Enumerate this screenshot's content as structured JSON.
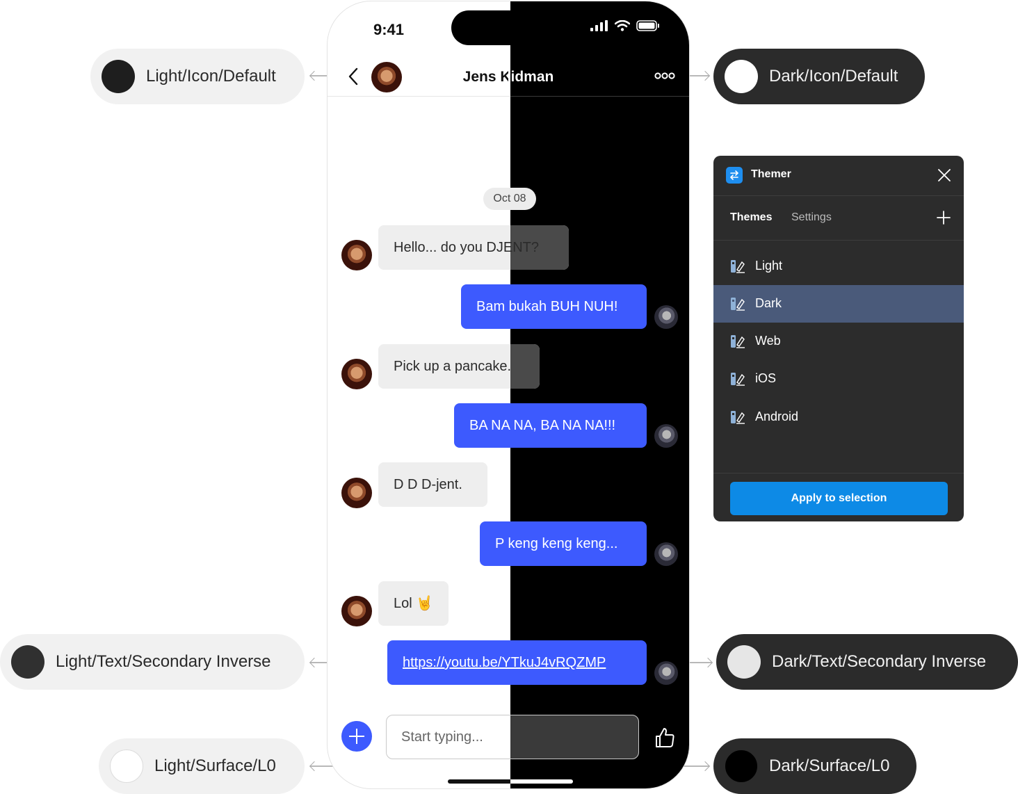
{
  "tokens": {
    "light_icon": {
      "label": "Light/Icon/Default",
      "color": "#1e1e1e"
    },
    "dark_icon": {
      "label": "Dark/Icon/Default",
      "color": "#ffffff"
    },
    "light_text": {
      "label": "Light/Text/Secondary Inverse",
      "color": "#303030"
    },
    "dark_text": {
      "label": "Dark/Text/Secondary Inverse",
      "color": "#e6e6e6"
    },
    "light_surface": {
      "label": "Light/Surface/L0",
      "color": "#ffffff"
    },
    "dark_surface": {
      "label": "Dark/Surface/L0",
      "color": "#000000"
    }
  },
  "phone": {
    "time": "9:41",
    "contact": "Jens Kidman",
    "date_chip": "Oct 08",
    "messages": [
      {
        "dir": "in",
        "text": "Hello... do you DJENT?"
      },
      {
        "dir": "out",
        "text": "Bam bukah BUH NUH!"
      },
      {
        "dir": "in",
        "text": "Pick up a pancake."
      },
      {
        "dir": "out",
        "text": "BA NA NA, BA NA NA!!!"
      },
      {
        "dir": "in",
        "text": "D D D-jent."
      },
      {
        "dir": "out",
        "text": "P keng keng keng..."
      },
      {
        "dir": "in",
        "text": "Lol 🤘"
      },
      {
        "dir": "out",
        "text": "https://youtu.be/YTkuJ4vRQZMP",
        "link": true
      }
    ],
    "input_placeholder": "Start typing...",
    "colors": {
      "bubble_out": "#3d5afe",
      "bubble_in_light": "#eeeeee",
      "bubble_in_dark": "#4a4a4a"
    }
  },
  "themer": {
    "title": "Themer",
    "tabs": [
      "Themes",
      "Settings"
    ],
    "themes": [
      "Light",
      "Dark",
      "Web",
      "iOS",
      "Android"
    ],
    "selected_theme": "Dark",
    "apply_label": "Apply to selection",
    "colors": {
      "panel": "#2c2c2c",
      "selected_row": "#4a5a7a",
      "accent": "#0d8ae6"
    }
  }
}
